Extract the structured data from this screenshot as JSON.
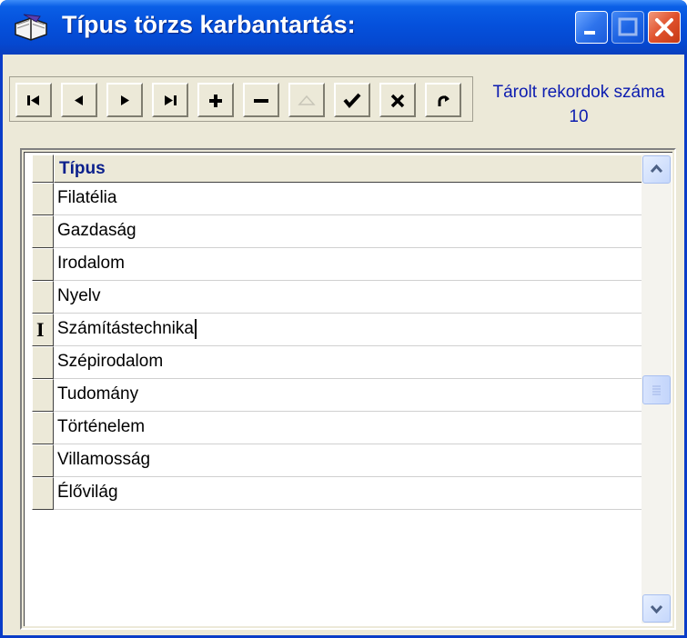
{
  "window": {
    "title": "Típus törzs karbantartás:",
    "icon": "book-icon"
  },
  "toolbar": {
    "buttons": [
      {
        "name": "first-record-button",
        "icon": "skip-first-icon",
        "enabled": true
      },
      {
        "name": "prior-record-button",
        "icon": "triangle-left-icon",
        "enabled": true
      },
      {
        "name": "next-record-button",
        "icon": "triangle-right-icon",
        "enabled": true
      },
      {
        "name": "last-record-button",
        "icon": "skip-last-icon",
        "enabled": true
      },
      {
        "name": "insert-record-button",
        "icon": "plus-icon",
        "enabled": true
      },
      {
        "name": "delete-record-button",
        "icon": "minus-icon",
        "enabled": true
      },
      {
        "name": "edit-record-button",
        "icon": "triangle-up-icon",
        "enabled": false
      },
      {
        "name": "post-record-button",
        "icon": "checkmark-icon",
        "enabled": true
      },
      {
        "name": "cancel-edit-button",
        "icon": "x-icon",
        "enabled": true
      },
      {
        "name": "refresh-button",
        "icon": "refresh-icon",
        "enabled": true
      }
    ]
  },
  "record_count": {
    "label": "Tárolt rekordok száma",
    "value": "10"
  },
  "grid": {
    "column_header": "Típus",
    "active_row_index": 4,
    "rows": [
      "Filatélia",
      "Gazdaság",
      "Irodalom",
      "Nyelv",
      "Számítástechnika",
      "Szépirodalom",
      "Tudomány",
      "Történelem",
      "Villamosság",
      "Élővilág"
    ]
  },
  "colors": {
    "titlebar": "#0551dc",
    "header_text": "#0a1f8c",
    "record_count_text": "#0c1cb0"
  }
}
